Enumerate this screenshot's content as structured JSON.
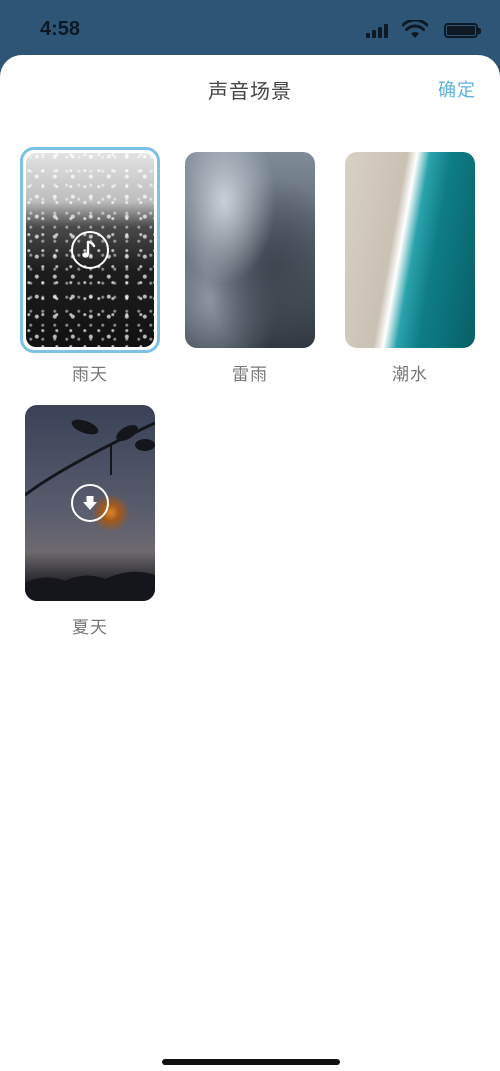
{
  "status_bar": {
    "time": "4:58",
    "icons": [
      "signal-icon",
      "wifi-icon",
      "battery-icon"
    ]
  },
  "header": {
    "title": "声音场景",
    "confirm_label": "确定"
  },
  "colors": {
    "accent": "#5db3de",
    "selected_border": "#7cc1e6",
    "status_bar_bg": "#2f5576"
  },
  "scenes": [
    {
      "label": "雨天",
      "selected": true,
      "badge_icon": "music-note-icon"
    },
    {
      "label": "雷雨",
      "selected": false,
      "badge_icon": ""
    },
    {
      "label": "潮水",
      "selected": false,
      "badge_icon": ""
    },
    {
      "label": "夏天",
      "selected": false,
      "badge_icon": "download-icon"
    }
  ]
}
